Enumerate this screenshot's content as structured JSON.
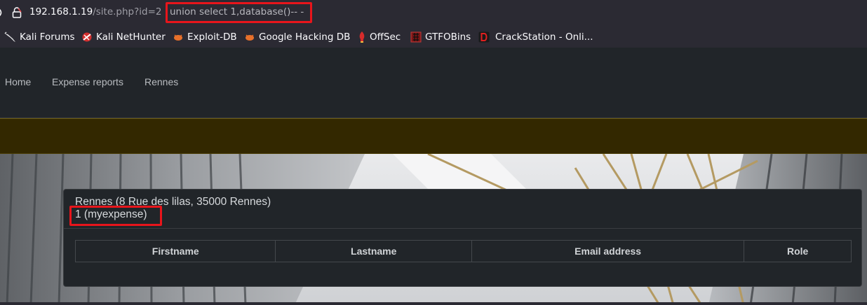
{
  "browser": {
    "url_host": "192.168.1.19",
    "url_path": "/site.php?id=2",
    "url_injection": " union select 1,database()-- -",
    "bookmarks": [
      {
        "label": "Kali Forums",
        "icon": "kali-dragon-icon"
      },
      {
        "label": "Kali NetHunter",
        "icon": "nethunter-icon"
      },
      {
        "label": "Exploit-DB",
        "icon": "exploitdb-bug-icon"
      },
      {
        "label": "Google Hacking DB",
        "icon": "ghdb-bug-icon"
      },
      {
        "label": "OffSec",
        "icon": "offsec-flame-icon"
      },
      {
        "label": "GTFOBins",
        "icon": "gtfobins-grid-icon"
      },
      {
        "label": "CrackStation - Onli...",
        "icon": "crackstation-d-icon"
      }
    ]
  },
  "nav": {
    "items": [
      "Home",
      "Expense reports",
      "Rennes"
    ]
  },
  "site_card": {
    "title": "Rennes (8 Rue des lilas, 35000 Rennes)",
    "subtitle": "1 (myexpense)",
    "table_headers": [
      "Firstname",
      "Lastname",
      "Email address",
      "Role"
    ]
  },
  "colors": {
    "highlight": "#e8151b",
    "banner": "#332800",
    "navbar": "#212529"
  }
}
